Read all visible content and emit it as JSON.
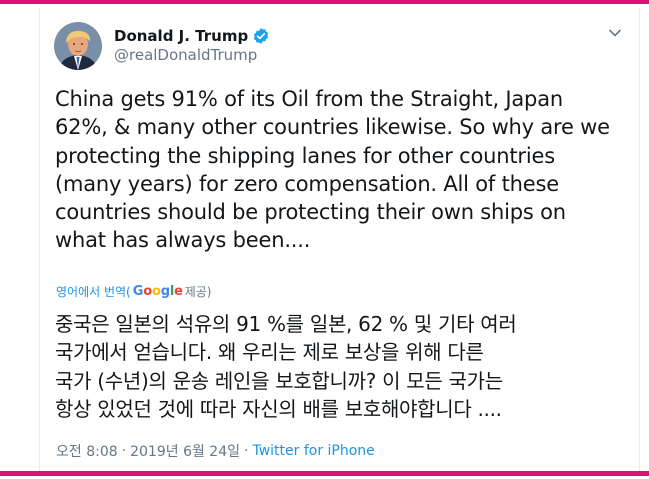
{
  "colors": {
    "accent_bar": "#e0107a",
    "link": "#1b95e0",
    "verified": "#1da1f2",
    "text": "#14171a",
    "muted": "#657786"
  },
  "author": {
    "display_name": "Donald J. Trump",
    "handle": "@realDonaldTrump",
    "verified_icon": "verified-badge-icon",
    "avatar": "profile-photo"
  },
  "menu": {
    "icon": "chevron-down-icon"
  },
  "tweet": {
    "text": "China gets 91% of its Oil from the Straight, Japan\n62%, & many other countries likewise. So why are we\nprotecting the shipping lanes for other countries\n(many years) for zero compensation. All of these\ncountries should be protecting their own ships on\nwhat has always been...."
  },
  "translation": {
    "link_label": "영어에서 번역(",
    "google": "Google",
    "provided": " 제공)",
    "text": "중국은 일본의 석유의 91 %를 일본, 62 % 및 기타 여러\n국가에서 얻습니다. 왜 우리는 제로 보상을 위해 다른\n국가 (수년)의 운송 레인을 보호합니까? 이 모든 국가는\n항상 있었던 것에 따라 자신의 배를 보호해야합니다 ...."
  },
  "meta": {
    "time": "오전 8:08",
    "separator": "·",
    "date": "2019년 6월 24일",
    "source": "Twitter for iPhone"
  }
}
